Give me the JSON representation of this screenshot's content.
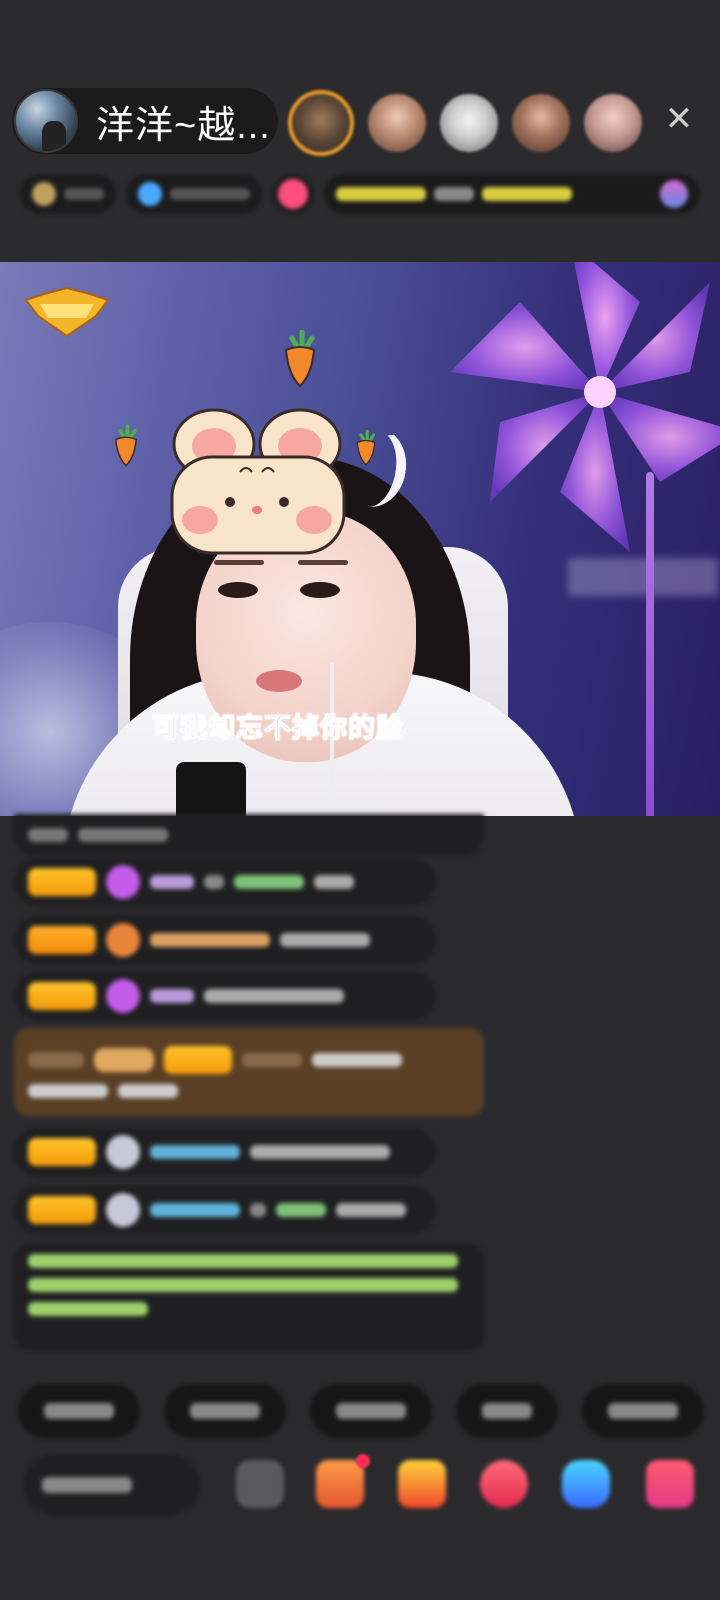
{
  "header": {
    "host_name": "洋洋~越...",
    "close_symbol": "✕",
    "viewers": [
      "top-viewer-1",
      "viewer-2",
      "viewer-3",
      "viewer-4",
      "viewer-5"
    ]
  },
  "video": {
    "lyric": "可我却忘不掉你的脸"
  },
  "colors": {
    "background": "#2a2a2c",
    "level_badge": "#f5a915",
    "lyric": "#b35cff",
    "top_viewer_ring": "#e79a2c"
  }
}
